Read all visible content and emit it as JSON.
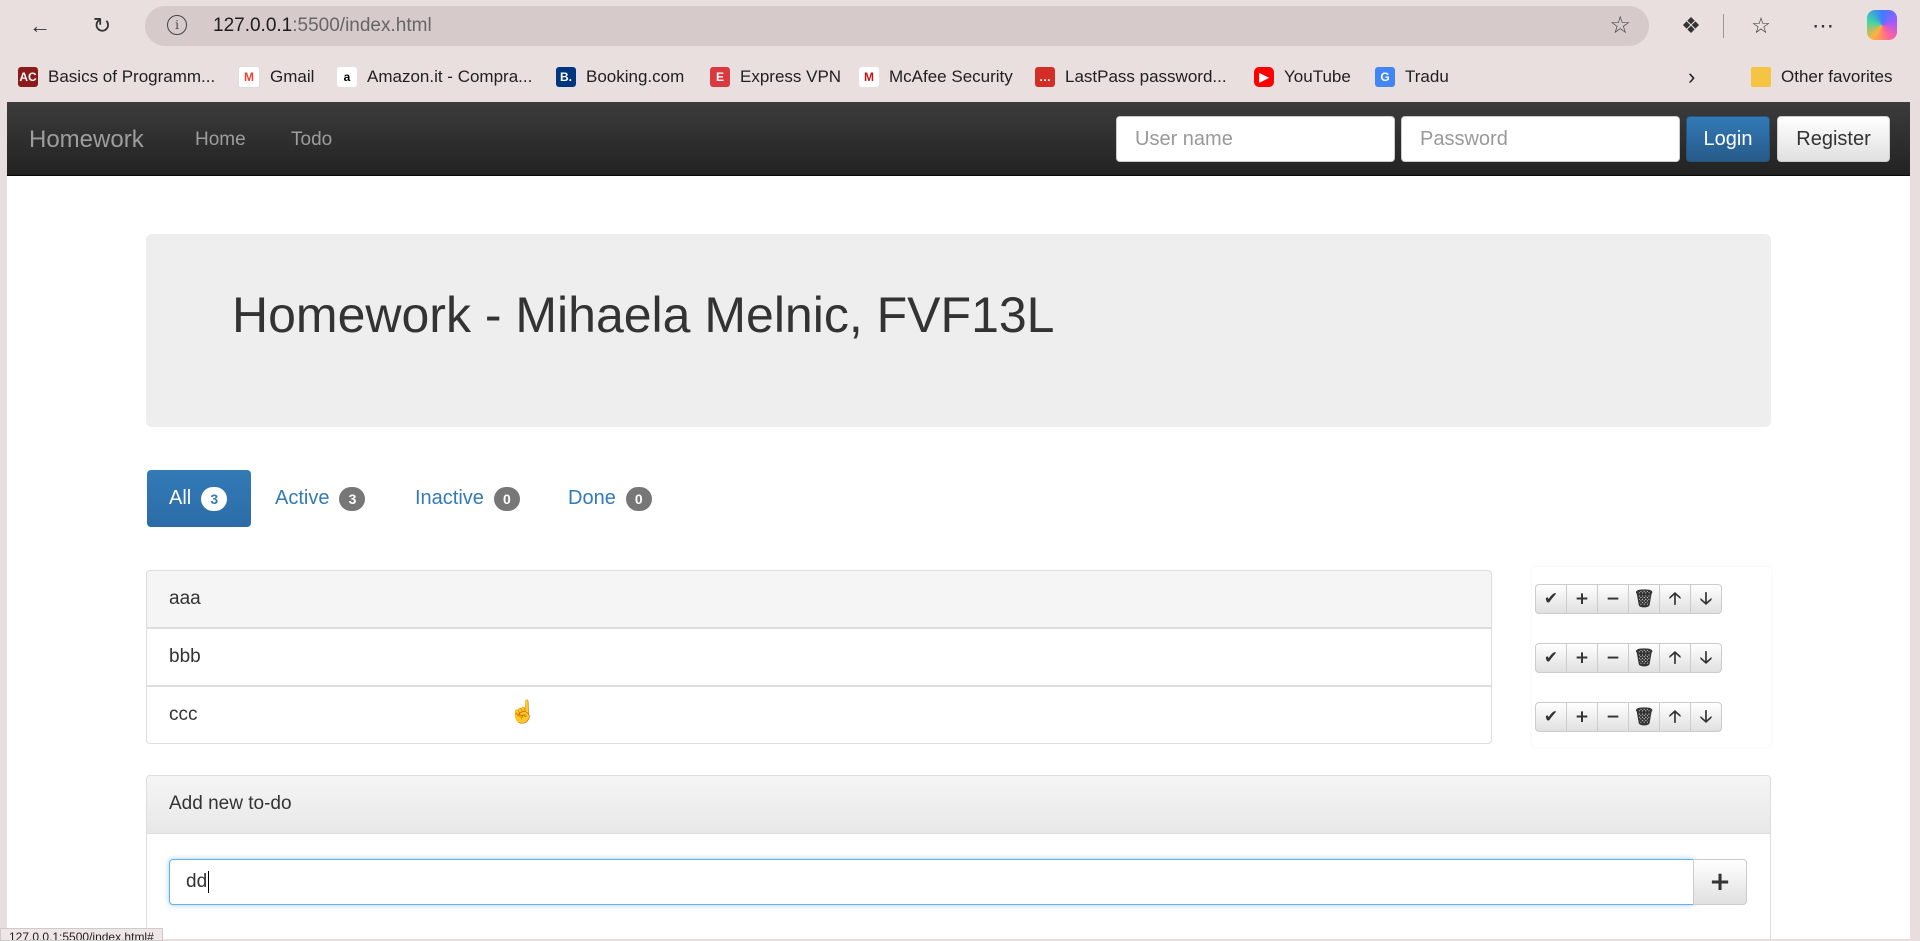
{
  "browser": {
    "url_host": "127.0.0.1",
    "url_rest": ":5500/index.html",
    "status_url": "127.0.0.1:5500/index.html#",
    "bookmarks": [
      {
        "label": "Basics of Programm...",
        "icon": "acm-icon",
        "color": "#8b1a1a"
      },
      {
        "label": "Gmail",
        "icon": "gmail-icon",
        "color": "#ea4335"
      },
      {
        "label": "Amazon.it - Compra...",
        "icon": "amazon-icon",
        "color": "#000000"
      },
      {
        "label": "Booking.com",
        "icon": "booking-icon",
        "color": "#003580"
      },
      {
        "label": "Express VPN",
        "icon": "expressvpn-icon",
        "color": "#da3940"
      },
      {
        "label": "McAfee Security",
        "icon": "mcafee-icon",
        "color": "#c01818"
      },
      {
        "label": "LastPass password...",
        "icon": "lastpass-icon",
        "color": "#d32d27"
      },
      {
        "label": "YouTube",
        "icon": "youtube-icon",
        "color": "#ff0000"
      },
      {
        "label": "Tradu",
        "icon": "translate-icon",
        "color": "#4285f4"
      }
    ],
    "other_favorites": "Other favorites"
  },
  "navbar": {
    "brand": "Homework",
    "links": [
      "Home",
      "Todo"
    ],
    "username_placeholder": "User name",
    "password_placeholder": "Password",
    "login": "Login",
    "register": "Register"
  },
  "jumbotron": {
    "title": "Homework - Mihaela Melnic, FVF13L"
  },
  "filters": [
    {
      "label": "All",
      "count": "3",
      "active": true
    },
    {
      "label": "Active",
      "count": "3"
    },
    {
      "label": "Inactive",
      "count": "0"
    },
    {
      "label": "Done",
      "count": "0"
    }
  ],
  "todos": [
    "aaa",
    "bbb",
    "ccc"
  ],
  "todo_actions": [
    "check-icon",
    "plus-icon",
    "minus-icon",
    "trash-icon",
    "arrow-up-icon",
    "arrow-down-icon"
  ],
  "new_todo": {
    "heading": "Add new to-do",
    "value": "dd"
  },
  "colors": {
    "primary": "#337ab7",
    "navbar": "#222222",
    "badge": "#777777"
  }
}
